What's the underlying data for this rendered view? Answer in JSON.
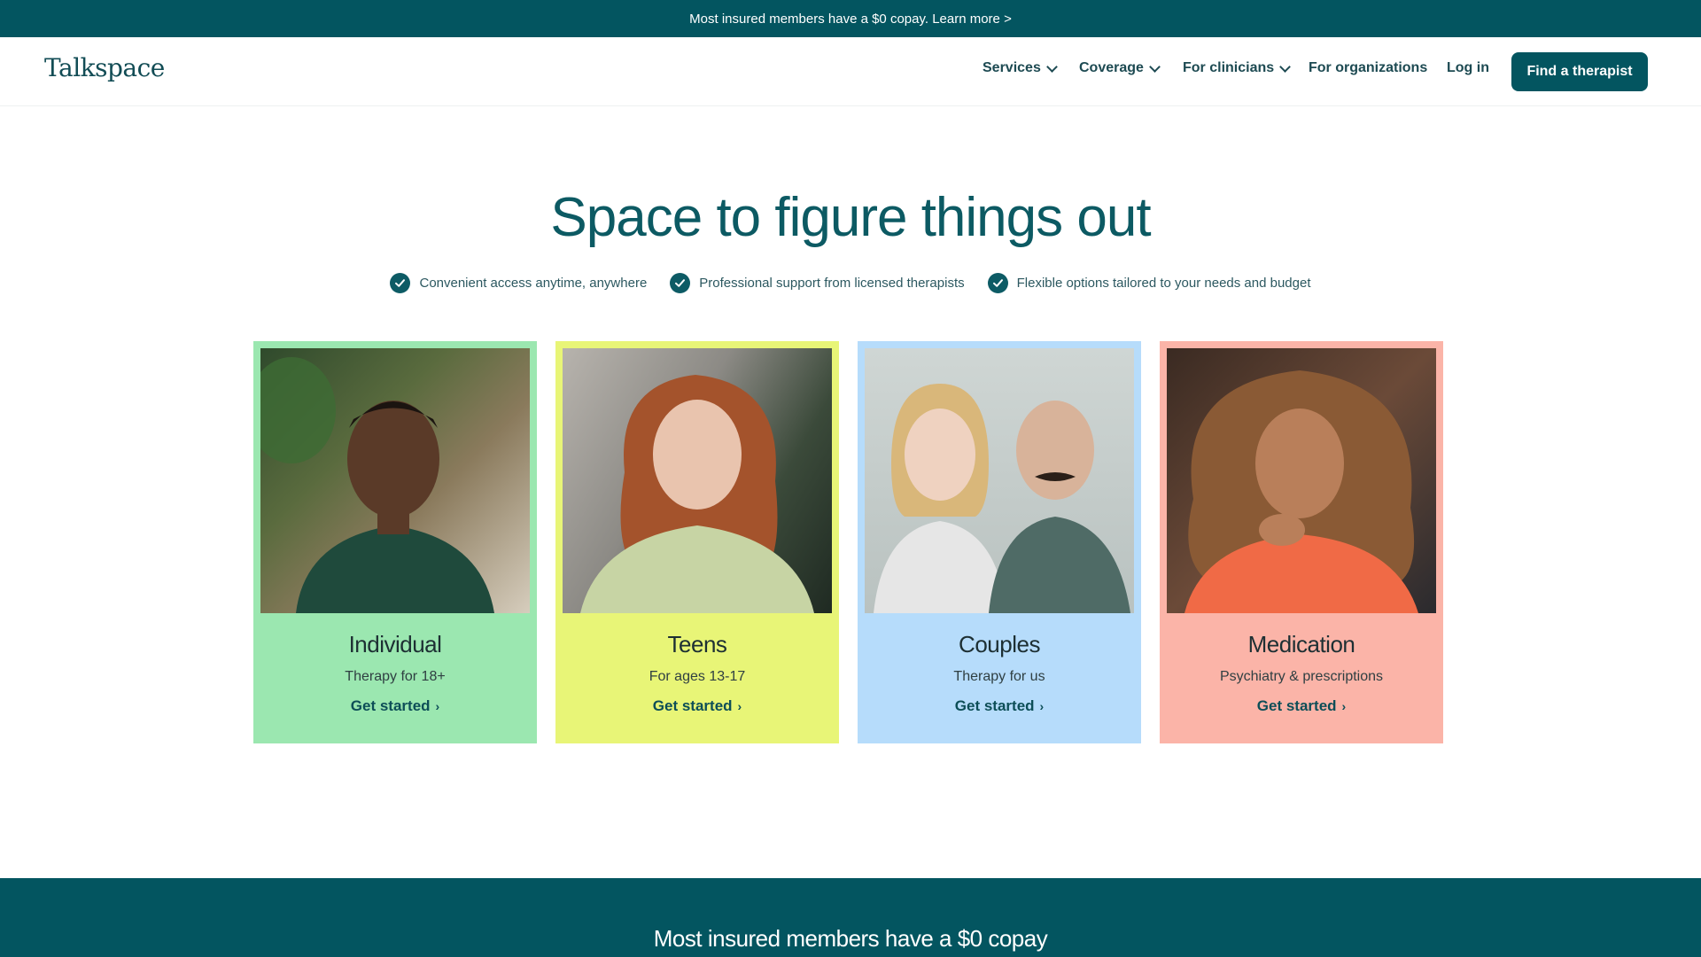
{
  "announcement": {
    "text": "Most insured members have a $0 copay. Learn more >"
  },
  "nav": {
    "logo": "Talkspace",
    "items": [
      {
        "label": "Services",
        "dropdown": true
      },
      {
        "label": "Coverage",
        "dropdown": true
      },
      {
        "label": "For clinicians",
        "dropdown": true
      },
      {
        "label": "For organizations",
        "dropdown": false
      },
      {
        "label": "Log in",
        "dropdown": false
      }
    ],
    "cta": "Find a therapist"
  },
  "hero": {
    "title": "Space to figure things out",
    "features": [
      "Convenient access anytime, anywhere",
      "Professional support from licensed therapists",
      "Flexible options tailored to your needs and budget"
    ]
  },
  "cards": [
    {
      "title": "Individual",
      "subtitle": "Therapy for 18+",
      "link": "Get started",
      "color": "#9be7b0"
    },
    {
      "title": "Teens",
      "subtitle": "For ages 13-17",
      "link": "Get started",
      "color": "#e8f577"
    },
    {
      "title": "Couples",
      "subtitle": "Therapy for us",
      "link": "Get started",
      "color": "#b6dcfb"
    },
    {
      "title": "Medication",
      "subtitle": "Psychiatry & prescriptions",
      "link": "Get started",
      "color": "#fbb4a8"
    }
  ],
  "bottom_banner": {
    "title": "Most insured members have a $0 copay"
  },
  "colors": {
    "brand": "#035560",
    "text_teal": "#0c5a63"
  }
}
